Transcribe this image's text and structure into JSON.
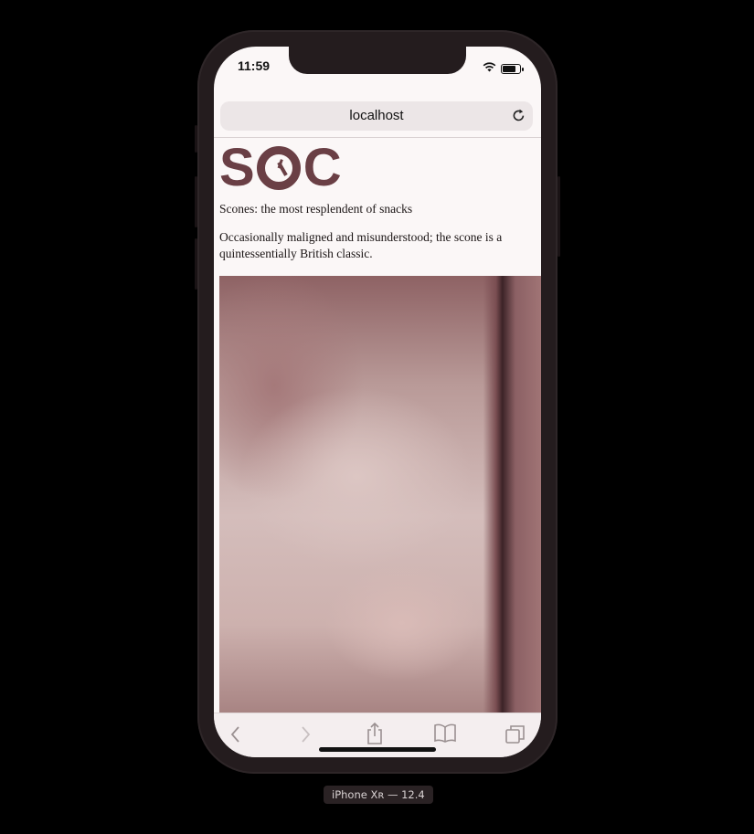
{
  "status_bar": {
    "time": "11:59"
  },
  "browser": {
    "address": "localhost",
    "icons": {
      "reload": "reload-icon",
      "back": "back-icon",
      "forward": "forward-icon",
      "share": "share-icon",
      "bookmarks": "bookmarks-icon",
      "tabs": "tabs-icon"
    }
  },
  "page": {
    "logo": {
      "left_letter": "S",
      "right_letter": "C"
    },
    "tagline": "Scones: the most resplendent of snacks",
    "intro": "Occasionally maligned and misunderstood; the scone is a quintessentially British classic."
  },
  "device": {
    "label": "iPhone Xʀ — 12.4"
  },
  "colors": {
    "logo": "#6a3f45",
    "page_background": "#fbf7f7",
    "device_frame": "#241c1e"
  }
}
